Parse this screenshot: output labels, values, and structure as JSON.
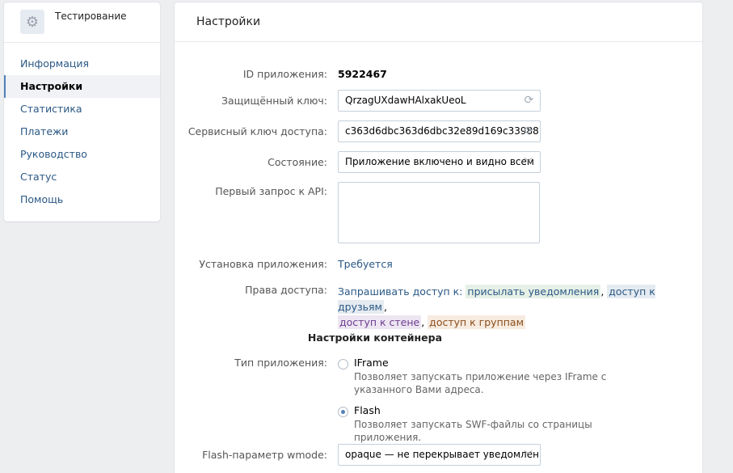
{
  "sidebar": {
    "app_title": "Тестирование",
    "items": [
      {
        "label": "Информация"
      },
      {
        "label": "Настройки"
      },
      {
        "label": "Статистика"
      },
      {
        "label": "Платежи"
      },
      {
        "label": "Руководство"
      },
      {
        "label": "Статус"
      },
      {
        "label": "Помощь"
      }
    ]
  },
  "main": {
    "title": "Настройки",
    "app_id": {
      "label": "ID приложения:",
      "value": "5922467"
    },
    "secret_key": {
      "label": "Защищённый ключ:",
      "value": "QrzagUXdawHAlxakUeoL"
    },
    "service_key": {
      "label": "Сервисный ключ доступа:",
      "value": "c363d6dbc363d6dbc32e89d169c33988"
    },
    "state": {
      "label": "Состояние:",
      "value": "Приложение включено и видно всем"
    },
    "first_request": {
      "label": "Первый запрос к API:",
      "value": ""
    },
    "install": {
      "label": "Установка приложения:",
      "value": "Требуется"
    },
    "access": {
      "label": "Права доступа:",
      "prefix": "Запрашивать доступ к:",
      "tags": [
        "присылать уведомления",
        "доступ к друзьям",
        "доступ к стене",
        "доступ к группам"
      ]
    },
    "container_title": "Настройки контейнера",
    "app_type": {
      "label": "Тип приложения:",
      "options": [
        {
          "title": "IFrame",
          "desc": "Позволяет запускать приложение через IFrame с указанного Вами адреса.",
          "selected": false
        },
        {
          "title": "Flash",
          "desc": "Позволяет запускать SWF-файлы со страницы приложения.",
          "selected": true
        }
      ]
    },
    "wmode": {
      "label": "Flash-параметр wmode:",
      "value": "opaque — не перекрывает уведомлен..."
    }
  },
  "icons": {
    "app": "gear-icon",
    "refresh": "refresh-icon",
    "dropdown": "chevron-down-icon"
  }
}
